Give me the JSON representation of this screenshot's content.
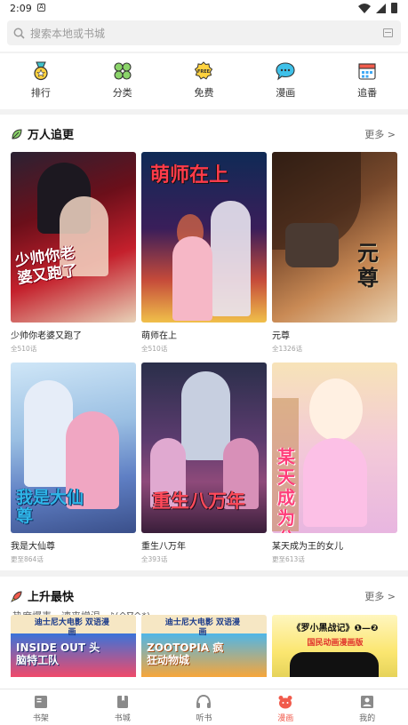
{
  "status": {
    "time": "2:09",
    "notif": "A"
  },
  "search": {
    "placeholder": "搜索本地或书城"
  },
  "quicknav": [
    {
      "label": "排行",
      "icon": "medal-icon"
    },
    {
      "label": "分类",
      "icon": "clover-icon"
    },
    {
      "label": "免费",
      "icon": "free-badge-icon"
    },
    {
      "label": "漫画",
      "icon": "chat-bubble-icon"
    },
    {
      "label": "追番",
      "icon": "calendar-icon"
    }
  ],
  "section1": {
    "title": "万人追更",
    "more": "更多 >",
    "books": [
      {
        "title": "少帅你老婆又跑了",
        "meta": "全510话",
        "cover_text": "少帅你老婆又跑了"
      },
      {
        "title": "萌师在上",
        "meta": "全510话",
        "cover_text": "萌师在上"
      },
      {
        "title": "元尊",
        "meta": "全1326话",
        "cover_text": "元尊"
      },
      {
        "title": "我是大仙尊",
        "meta": "更至864话",
        "cover_text": "我是大仙尊"
      },
      {
        "title": "重生八万年",
        "meta": "全393话",
        "cover_text": "重生八万年"
      },
      {
        "title": "某天成为王的女儿",
        "meta": "更至613话",
        "cover_text": "某天成为公主"
      }
    ]
  },
  "section2": {
    "title": "上升最快",
    "subtitle": "热度爆表，速来增温~♪(^∇^*)~",
    "more": "更多 >",
    "promos": [
      {
        "tag": "迪士尼大电影 双语漫画",
        "text": "INSIDE OUT 头脑特工队"
      },
      {
        "tag": "迪士尼大电影 双语漫画",
        "text": "ZOOTOPIA 疯狂动物城"
      },
      {
        "tag": "《罗小黑战记》❶—❷",
        "text": "国民动画漫画版"
      }
    ]
  },
  "tabs": [
    {
      "label": "书架",
      "icon": "bookshelf-icon",
      "active": false
    },
    {
      "label": "书城",
      "icon": "book-icon",
      "active": false
    },
    {
      "label": "听书",
      "icon": "headphones-icon",
      "active": false
    },
    {
      "label": "漫画",
      "icon": "comic-mascot-icon",
      "active": true
    },
    {
      "label": "我的",
      "icon": "profile-icon",
      "active": false
    }
  ]
}
